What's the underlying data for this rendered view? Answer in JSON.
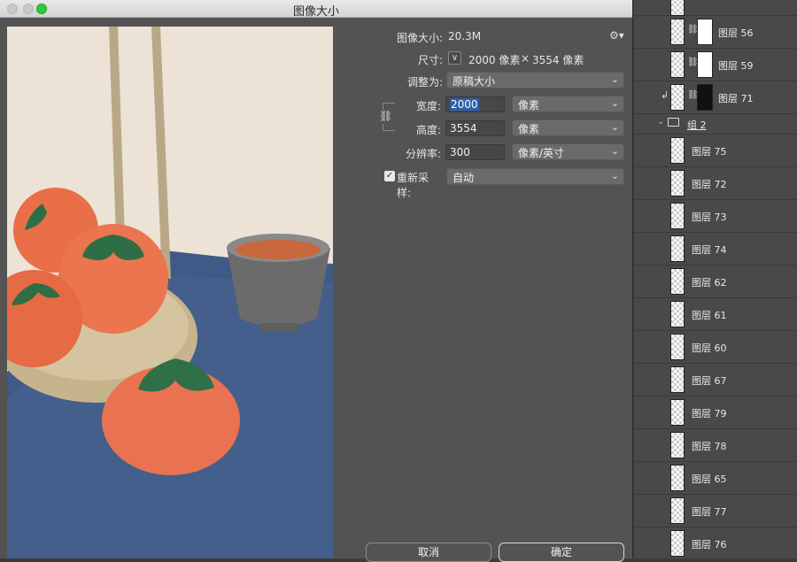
{
  "window": {
    "title": "图像大小"
  },
  "image_size": {
    "label": "图像大小:",
    "value": "20.3M",
    "gear_icon": "gear-icon"
  },
  "dimensions": {
    "label": "尺寸:",
    "width_text": "2000 像素",
    "times": "×",
    "height_text": "3554 像素"
  },
  "fit_to": {
    "label": "调整为:",
    "value": "原稿大小"
  },
  "width": {
    "label": "宽度:",
    "value": "2000",
    "unit": "像素"
  },
  "height": {
    "label": "高度:",
    "value": "3554",
    "unit": "像素"
  },
  "resolution": {
    "label": "分辨率:",
    "value": "300",
    "unit": "像素/英寸"
  },
  "resample": {
    "label": "重新采样:",
    "checked": true,
    "value": "自动"
  },
  "buttons": {
    "cancel": "取消",
    "ok": "确定"
  },
  "layers_panel": {
    "top_layers": [
      {
        "name": "图层 56",
        "has_mask": true
      },
      {
        "name": "图层 59",
        "has_mask": true
      },
      {
        "name": "图层 71",
        "has_mask": true,
        "clipped": true
      }
    ],
    "group": {
      "name": "组 2"
    },
    "group_layers": [
      {
        "name": "图层 75"
      },
      {
        "name": "图层 72"
      },
      {
        "name": "图层 73"
      },
      {
        "name": "图层 74"
      },
      {
        "name": "图层 62"
      },
      {
        "name": "图层 61"
      },
      {
        "name": "图层 60"
      },
      {
        "name": "图层 67"
      },
      {
        "name": "图层 79"
      },
      {
        "name": "图层 78"
      },
      {
        "name": "图层 65"
      },
      {
        "name": "图层 77"
      },
      {
        "name": "图层 76"
      }
    ]
  },
  "colors": {
    "dialog_bg": "#535353",
    "panel_bg": "#494949",
    "selection_blue": "#2c5fa8",
    "traffic_green": "#2fc840"
  }
}
